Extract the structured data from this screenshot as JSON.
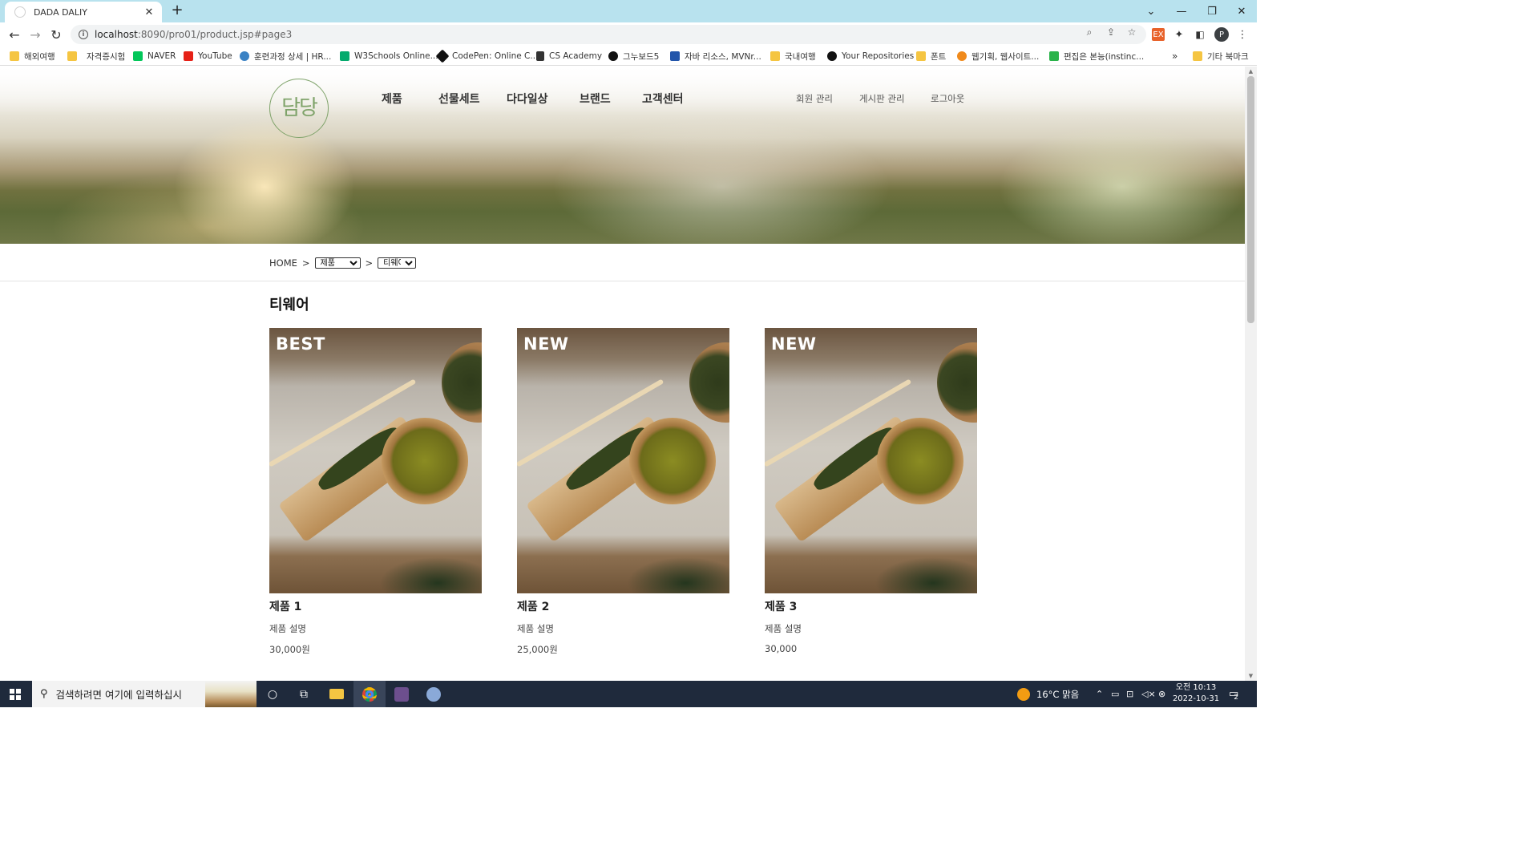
{
  "browser": {
    "tab_title": "DADA DALIY",
    "url_host": "localhost",
    "url_rest": ":8090/pro01/product.jsp#page3",
    "window_controls": [
      "⌄",
      "—",
      "❐",
      "✕"
    ]
  },
  "bookmarks": [
    {
      "label": "해외여행",
      "icon": "folder-icon"
    },
    {
      "label": "자격증시험",
      "icon": "folder-icon"
    },
    {
      "label": "NAVER",
      "icon": "naver-icon"
    },
    {
      "label": "YouTube",
      "icon": "youtube-icon"
    },
    {
      "label": "훈련과정 상세 | HR...",
      "icon": "hrd-icon"
    },
    {
      "label": "W3Schools Online...",
      "icon": "w3schools-icon"
    },
    {
      "label": "CodePen: Online C...",
      "icon": "codepen-icon"
    },
    {
      "label": "CS Academy",
      "icon": "cs-academy-icon"
    },
    {
      "label": "그누보드5",
      "icon": "gnuboard-icon"
    },
    {
      "label": "자바 리소스, MVNr...",
      "icon": "mvn-icon"
    },
    {
      "label": "국내여행",
      "icon": "folder-icon"
    },
    {
      "label": "Your Repositories",
      "icon": "github-icon"
    },
    {
      "label": "폰트",
      "icon": "folder-icon"
    },
    {
      "label": "웹기획, 웹사이트...",
      "icon": "orange-o-icon"
    },
    {
      "label": "편집은 본능(instinc...",
      "icon": "green-check-icon"
    }
  ],
  "bookmarks_more": "»",
  "bookmarks_other": "기타 북마크",
  "site": {
    "logo_text": "담당",
    "gnb": [
      "제품",
      "선물세트",
      "다다일상",
      "브랜드",
      "고객센터"
    ],
    "util": [
      "회원 관리",
      "게시판 관리",
      "로그아웃"
    ]
  },
  "breadcrumb": {
    "home": "HOME",
    "sep": ">",
    "category_selected": "제품",
    "sub_selected": "티웨어"
  },
  "section_title": "티웨어",
  "products": [
    {
      "badge": "BEST",
      "name": "제품 1",
      "desc": "제품 설명",
      "price": "30,000원"
    },
    {
      "badge": "NEW",
      "name": "제품 2",
      "desc": "제품 설명",
      "price": "25,000원"
    },
    {
      "badge": "NEW",
      "name": "제품 3",
      "desc": "제품 설명",
      "price": "30,000"
    }
  ],
  "taskbar": {
    "search_placeholder": "검색하려면 여기에 입력하십시",
    "weather": "16°C  맑음",
    "time": "오전 10:13",
    "date": "2022-10-31",
    "notifications": "2"
  },
  "colors": {
    "tabbar": "#b8e2ee",
    "taskbar": "#1f2a3c",
    "logo_green": "#7fa36a"
  }
}
